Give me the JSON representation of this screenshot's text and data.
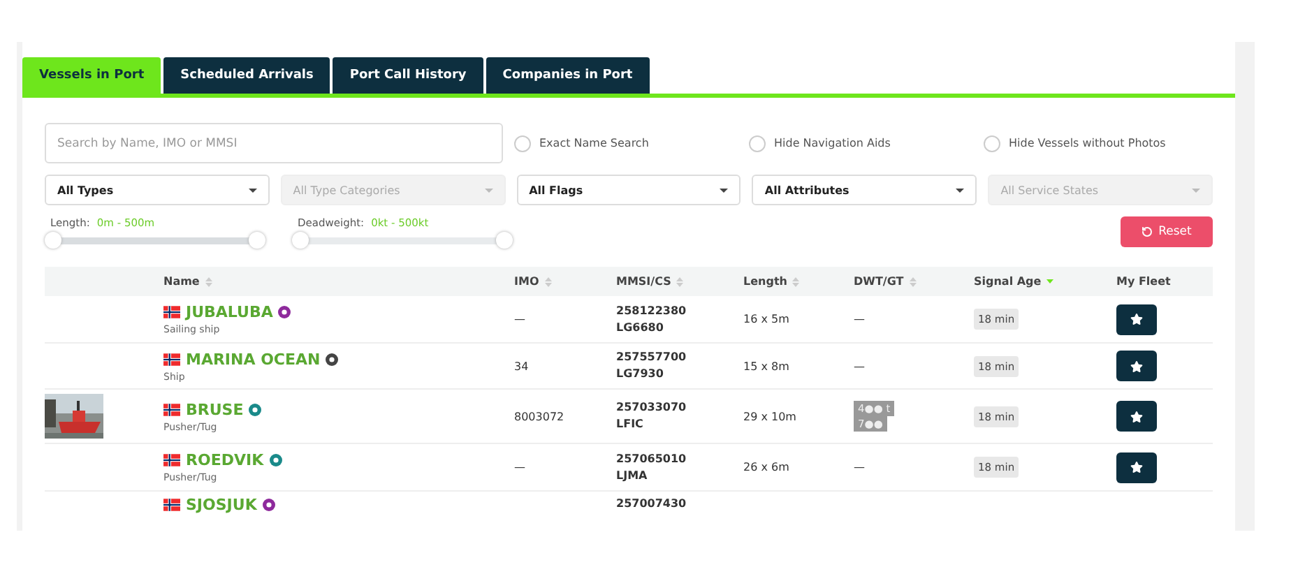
{
  "tabs": [
    {
      "label": "Vessels in Port",
      "selected": true
    },
    {
      "label": "Scheduled Arrivals",
      "selected": false
    },
    {
      "label": "Port Call History",
      "selected": false
    },
    {
      "label": "Companies in Port",
      "selected": false
    }
  ],
  "search": {
    "placeholder": "Search by Name, IMO or MMSI"
  },
  "options": [
    {
      "label": "Exact Name Search",
      "checked": false
    },
    {
      "label": "Hide Navigation Aids",
      "checked": false
    },
    {
      "label": "Hide Vessels without Photos",
      "checked": false
    }
  ],
  "dropdowns": [
    {
      "label": "All Types",
      "disabled": false
    },
    {
      "label": "All Type Categories",
      "disabled": true
    },
    {
      "label": "All Flags",
      "disabled": false
    },
    {
      "label": "All Attributes",
      "disabled": false
    },
    {
      "label": "All Service States",
      "disabled": true
    }
  ],
  "sliders": [
    {
      "label": "Length:",
      "reading": "0m - 500m",
      "level": 1
    },
    {
      "label": "Deadweight:",
      "reading": "0kt - 500kt",
      "level": 1
    }
  ],
  "reset_button": {
    "label": "Reset"
  },
  "table": {
    "columns": [
      {
        "label": "Name",
        "sortable": true,
        "sorted": false
      },
      {
        "label": "IMO",
        "sortable": true,
        "sorted": false
      },
      {
        "label": "MMSI/CS",
        "sortable": true,
        "sorted": false
      },
      {
        "label": "Length",
        "sortable": true,
        "sorted": false
      },
      {
        "label": "DWT/GT",
        "sortable": true,
        "sorted": false
      },
      {
        "label": "Signal Age",
        "sortable": true,
        "sorted": true
      },
      {
        "label": "My Fleet",
        "sortable": false
      }
    ],
    "rows": [
      {
        "photo": false,
        "name": "JUBALUBA",
        "color": "#8e2a9c",
        "type": "Sailing ship",
        "imo": "—",
        "mmsi": "258122380",
        "callsign": "LG6680",
        "length": "16 x 5m",
        "dwt": [
          "—"
        ],
        "signal_age": "18 min"
      },
      {
        "photo": false,
        "name": "MARINA OCEAN",
        "color": "#444444",
        "type": "Ship",
        "imo": "34",
        "mmsi": "257557700",
        "callsign": "LG7930",
        "length": "15 x 8m",
        "dwt": [
          "—"
        ],
        "signal_age": "18 min"
      },
      {
        "photo": true,
        "name": "BRUSE",
        "color": "#1a8a8a",
        "type": "Pusher/Tug",
        "imo": "8003072",
        "mmsi": "257033070",
        "callsign": "LFIC",
        "length": "29 x 10m",
        "dwt": [
          "4●● t",
          "7●●"
        ],
        "signal_age": "18 min"
      },
      {
        "photo": false,
        "name": "ROEDVIK",
        "color": "#1a8a8a",
        "type": "Pusher/Tug",
        "imo": "—",
        "mmsi": "257065010",
        "callsign": "LJMA",
        "length": "26 x 6m",
        "dwt": [
          "—"
        ],
        "signal_age": "18 min"
      },
      {
        "photo": false,
        "name": "SJOSJUK",
        "color": "#8e2a9c",
        "mmsi": "257007430",
        "partial": true
      }
    ]
  }
}
